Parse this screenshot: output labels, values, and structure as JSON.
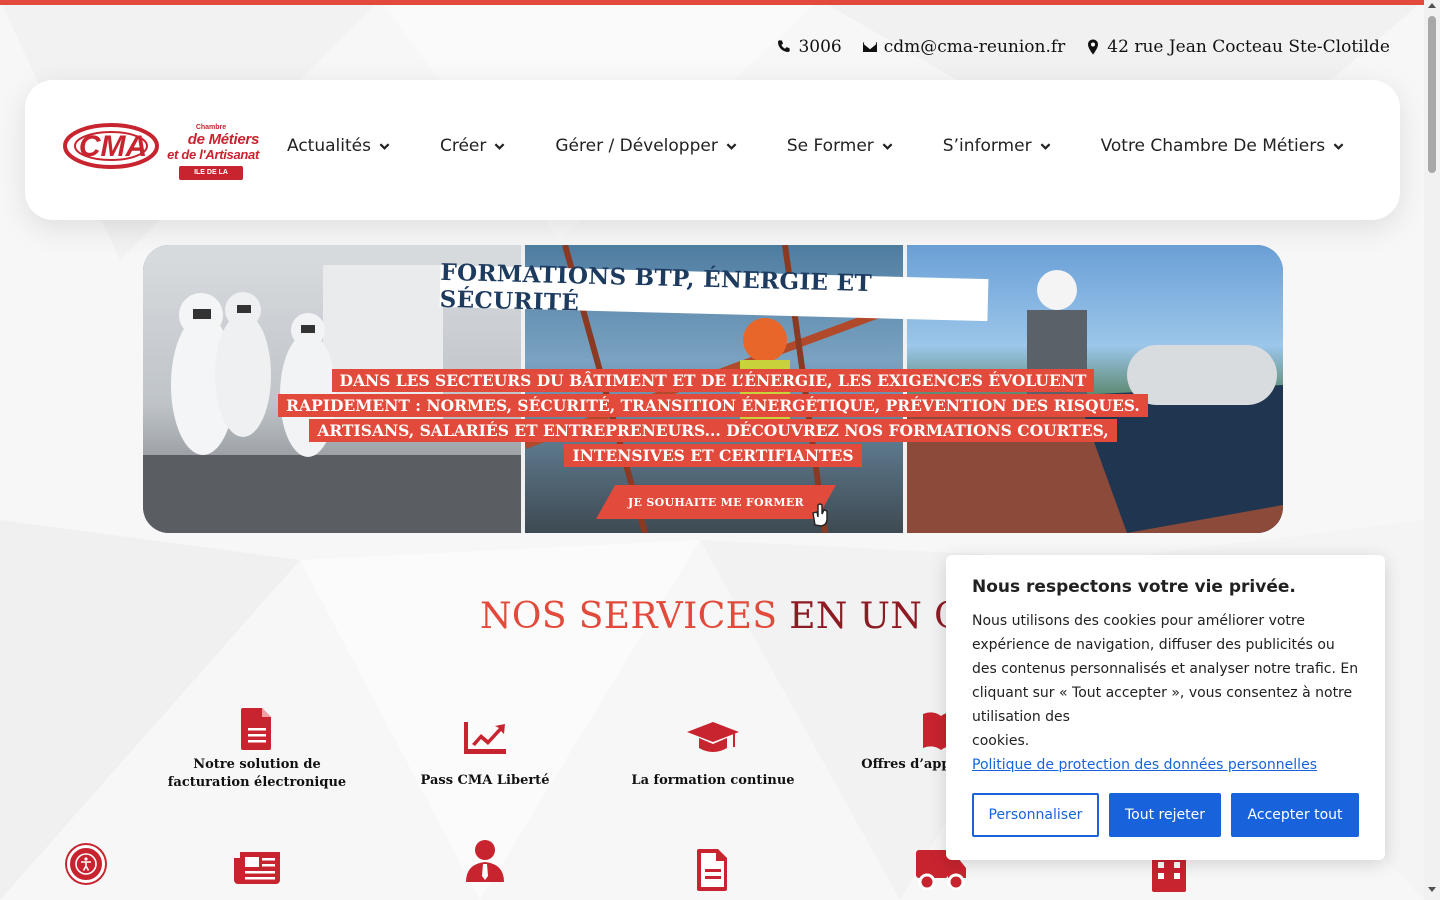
{
  "contact": {
    "phone": "3006",
    "email": "cdm@cma-reunion.fr",
    "address": "42 rue Jean Cocteau Ste-Clotilde"
  },
  "logo": {
    "mark": "CMA",
    "line1": "Chambre",
    "line2": "de Métiers",
    "line3": "et de l'Artisanat",
    "badge": "ILE DE LA RÉUNION"
  },
  "nav": {
    "items": [
      {
        "label": "Actualités"
      },
      {
        "label": "Créer"
      },
      {
        "label": "Gérer / Développer"
      },
      {
        "label": "Se Former"
      },
      {
        "label": "S’informer"
      },
      {
        "label": "Votre Chambre De Métiers"
      }
    ]
  },
  "banner": {
    "title": "FORMATIONS BTP, ÉNERGIE ET SÉCURITÉ",
    "lines": [
      "DANS LES SECTEURS DU BÂTIMENT ET DE L’ÉNERGIE, LES EXIGENCES ÉVOLUENT",
      "RAPIDEMENT : NORMES, SÉCURITÉ, TRANSITION ÉNERGÉTIQUE, PRÉVENTION DES RISQUES.",
      "ARTISANS, SALARIÉS ET ENTREPRENEURS... DÉCOUVREZ NOS FORMATIONS COURTES,",
      "INTENSIVES ET CERTIFIANTES"
    ],
    "cta": "JE SOUHAITE ME FORMER"
  },
  "services": {
    "title_part1": "NOS SERVICES",
    "title_part2": "EN UN CLIC",
    "items": [
      {
        "label": "Notre solution de facturation électronique",
        "icon": "document-icon"
      },
      {
        "label": "Pass CMA Liberté",
        "icon": "chart-line-icon"
      },
      {
        "label": "La formation continue",
        "icon": "graduation-cap-icon"
      },
      {
        "label": "Offres d’appr... pour...",
        "icon": "book-icon"
      }
    ],
    "row2_icons": [
      "newspaper-icon",
      "user-tie-icon",
      "file-icon",
      "truck-icon",
      "building-icon"
    ]
  },
  "cookie": {
    "title": "Nous respectons votre vie privée.",
    "body": "Nous utilisons des cookies pour améliorer votre expérience de navigation, diffuser des publicités ou des contenus personnalisés et analyser notre trafic. En cliquant sur « Tout accepter », vous consentez à notre utilisation des",
    "body2": "cookies.",
    "link": "Politique de protection des données personnelles",
    "btn_customize": "Personnaliser",
    "btn_reject": "Tout rejeter",
    "btn_accept": "Accepter tout"
  },
  "colors": {
    "brand_red": "#c8242f",
    "accent_red": "#e24b3b",
    "dark_red": "#8d1b24",
    "cookie_blue": "#1863dc"
  }
}
